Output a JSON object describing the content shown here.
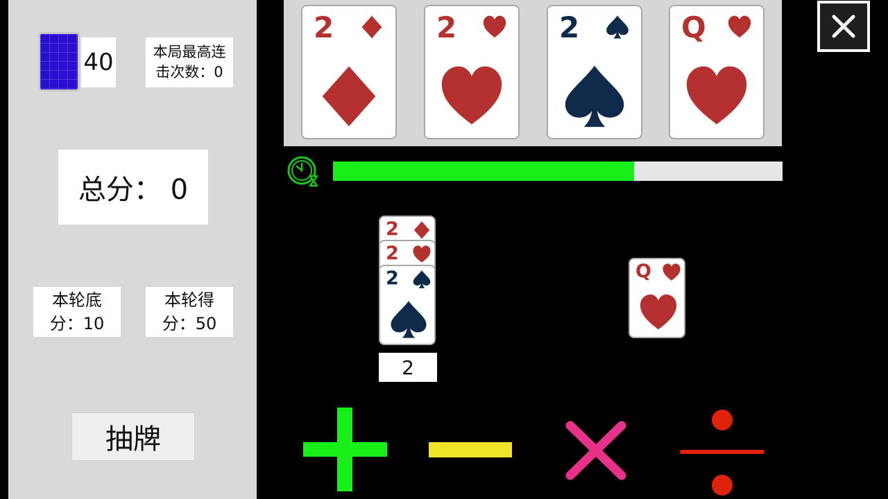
{
  "left_panel": {
    "deck_count": "40",
    "combo_line1": "本局最高连",
    "combo_line2": "击次数：0",
    "total_score": "总分： 0",
    "base_line1": "本轮底",
    "base_line2": "分：10",
    "round_line1": "本轮得",
    "round_line2": "分：50",
    "draw_button": "抽牌"
  },
  "top_cards": [
    {
      "rank": "2",
      "suit": "diamond",
      "color": "#b5312f"
    },
    {
      "rank": "2",
      "suit": "heart",
      "color": "#b5312f"
    },
    {
      "rank": "2",
      "suit": "spade",
      "color": "#0f2a4a"
    },
    {
      "rank": "Q",
      "suit": "heart",
      "color": "#b5312f"
    }
  ],
  "timer": {
    "progress": 0.67,
    "fill_color": "#18ef18",
    "icon": "clock-hourglass-icon"
  },
  "stack_cards": [
    {
      "rank": "2",
      "suit": "diamond",
      "color": "#b5312f"
    },
    {
      "rank": "2",
      "suit": "heart",
      "color": "#b5312f"
    },
    {
      "rank": "2",
      "suit": "spade",
      "color": "#0f2a4a"
    }
  ],
  "stack_value": "2",
  "right_card": {
    "rank": "Q",
    "suit": "heart",
    "color": "#b5312f"
  },
  "operators": [
    {
      "name": "plus",
      "color": "#18ef18"
    },
    {
      "name": "minus",
      "color": "#f0e428"
    },
    {
      "name": "multiply",
      "color": "#e8328a"
    },
    {
      "name": "divide",
      "color": "#e0220c"
    }
  ]
}
